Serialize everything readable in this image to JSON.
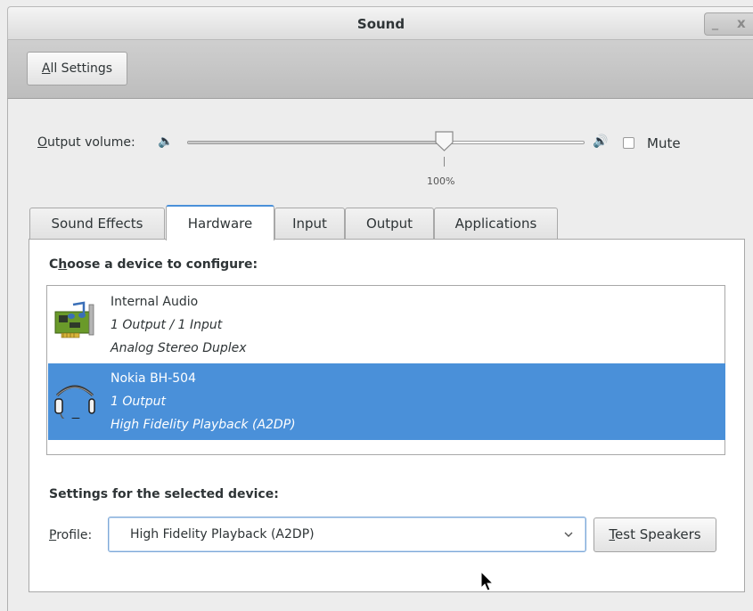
{
  "window": {
    "title": "Sound",
    "minimize_glyph": "_",
    "close_glyph": "x"
  },
  "toolbar": {
    "all_settings_mnemonic": "A",
    "all_settings_rest": "ll Settings"
  },
  "volume": {
    "label_mnemonic": "O",
    "label_rest": "utput volume:",
    "low_icon": "speaker-low-icon",
    "high_icon": "speaker-high-icon",
    "level_percent": 65,
    "mark_label": "100%",
    "mute_label": "Mute",
    "mute_checked": false
  },
  "tabs": [
    {
      "label": "Sound Effects",
      "active": false
    },
    {
      "label": "Hardware",
      "active": true
    },
    {
      "label": "Input",
      "active": false
    },
    {
      "label": "Output",
      "active": false
    },
    {
      "label": "Applications",
      "active": false
    }
  ],
  "hardware": {
    "choose_prefix": "C",
    "choose_mnemonic": "h",
    "choose_rest": "oose a device to configure:",
    "devices": [
      {
        "name": "Internal Audio",
        "io": "1 Output / 1 Input",
        "profile": "Analog Stereo Duplex",
        "icon": "sound-card-icon",
        "selected": false
      },
      {
        "name": "Nokia BH-504",
        "io": "1 Output",
        "profile": "High Fidelity Playback (A2DP)",
        "icon": "headset-icon",
        "selected": true
      }
    ],
    "settings_label": "Settings for the selected device:",
    "profile_mnemonic": "P",
    "profile_rest": "rofile:",
    "profile_value": "High Fidelity Playback (A2DP)",
    "test_mnemonic": "T",
    "test_rest": "est Speakers"
  },
  "colors": {
    "accent": "#4a90d9",
    "selected_text": "#ffffff"
  }
}
